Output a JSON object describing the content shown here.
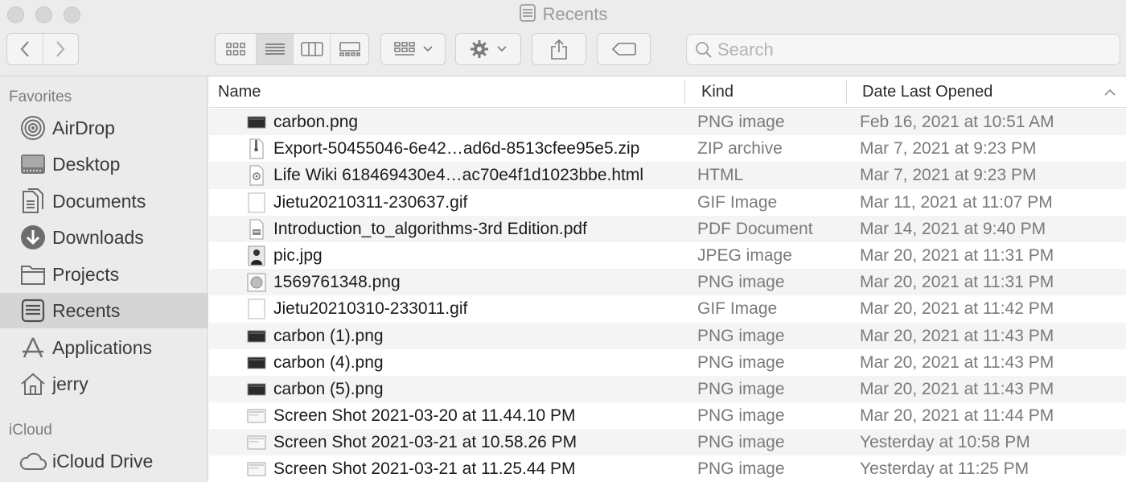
{
  "window": {
    "title": "Recents"
  },
  "toolbar": {
    "back_icon": "chevron-left-icon",
    "forward_icon": "chevron-right-icon",
    "view_modes": [
      "icon-view-icon",
      "list-view-icon",
      "column-view-icon",
      "gallery-view-icon"
    ],
    "active_view": "list",
    "group_icon": "group-by-icon",
    "action_icon": "gear-icon",
    "share_icon": "share-icon",
    "tag_icon": "tag-icon"
  },
  "search": {
    "placeholder": "Search",
    "value": ""
  },
  "sidebar": {
    "favorites_heading": "Favorites",
    "favorites": [
      {
        "label": "AirDrop",
        "icon": "airdrop-icon"
      },
      {
        "label": "Desktop",
        "icon": "desktop-icon"
      },
      {
        "label": "Documents",
        "icon": "documents-icon"
      },
      {
        "label": "Downloads",
        "icon": "downloads-icon"
      },
      {
        "label": "Projects",
        "icon": "folder-icon"
      },
      {
        "label": "Recents",
        "icon": "recents-icon",
        "selected": true
      },
      {
        "label": "Applications",
        "icon": "applications-icon"
      },
      {
        "label": "jerry",
        "icon": "home-icon"
      }
    ],
    "icloud_heading": "iCloud",
    "icloud": [
      {
        "label": "iCloud Drive",
        "icon": "cloud-icon"
      }
    ]
  },
  "columns": {
    "name": "Name",
    "kind": "Kind",
    "date": "Date Last Opened",
    "sort_icon": "chevron-up-icon"
  },
  "files": [
    {
      "name": "carbon.png",
      "kind": "PNG image",
      "date": "Feb 16, 2021 at 10:51 AM",
      "icon": "dark-image-thumbnail-icon"
    },
    {
      "name": "Export-50455046-6e42…ad6d-8513cfee95e5.zip",
      "kind": "ZIP archive",
      "date": "Mar 7, 2021 at 9:23 PM",
      "icon": "zip-file-icon"
    },
    {
      "name": "Life Wiki 618469430e4…ac70e4f1d1023bbe.html",
      "kind": "HTML",
      "date": "Mar 7, 2021 at 9:23 PM",
      "icon": "html-file-icon"
    },
    {
      "name": "Jietu20210311-230637.gif",
      "kind": "GIF Image",
      "date": "Mar 11, 2021 at 11:07 PM",
      "icon": "gif-file-icon"
    },
    {
      "name": "Introduction_to_algorithms-3rd Edition.pdf",
      "kind": "PDF Document",
      "date": "Mar 14, 2021 at 9:40 PM",
      "icon": "pdf-file-icon"
    },
    {
      "name": "pic.jpg",
      "kind": "JPEG image",
      "date": "Mar 20, 2021 at 11:31 PM",
      "icon": "photo-thumbnail-icon"
    },
    {
      "name": "1569761348.png",
      "kind": "PNG image",
      "date": "Mar 20, 2021 at 11:31 PM",
      "icon": "image-thumbnail-icon"
    },
    {
      "name": "Jietu20210310-233011.gif",
      "kind": "GIF Image",
      "date": "Mar 20, 2021 at 11:42 PM",
      "icon": "gif-file-icon"
    },
    {
      "name": "carbon (1).png",
      "kind": "PNG image",
      "date": "Mar 20, 2021 at 11:43 PM",
      "icon": "dark-image-thumbnail-icon"
    },
    {
      "name": "carbon (4).png",
      "kind": "PNG image",
      "date": "Mar 20, 2021 at 11:43 PM",
      "icon": "dark-image-thumbnail-icon"
    },
    {
      "name": "carbon (5).png",
      "kind": "PNG image",
      "date": "Mar 20, 2021 at 11:43 PM",
      "icon": "dark-image-thumbnail-icon"
    },
    {
      "name": "Screen Shot 2021-03-20 at 11.44.10 PM",
      "kind": "PNG image",
      "date": "Mar 20, 2021 at 11:44 PM",
      "icon": "screenshot-thumbnail-icon"
    },
    {
      "name": "Screen Shot 2021-03-21 at 10.58.26 PM",
      "kind": "PNG image",
      "date": "Yesterday at 10:58 PM",
      "icon": "screenshot-thumbnail-icon"
    },
    {
      "name": "Screen Shot 2021-03-21 at 11.25.44 PM",
      "kind": "PNG image",
      "date": "Yesterday at 11:25 PM",
      "icon": "screenshot-thumbnail-icon"
    }
  ]
}
